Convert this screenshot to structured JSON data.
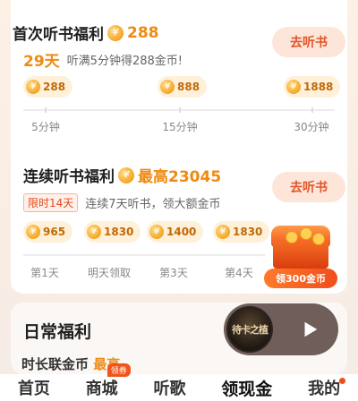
{
  "first_listen": {
    "title": "首次听书福利",
    "reward": "288",
    "days": "29天",
    "desc": "听满5分钟得288金币!",
    "button": "去听书",
    "pills": [
      "288",
      "888",
      "1888"
    ],
    "ticks": [
      "5分钟",
      "15分钟",
      "30分钟"
    ]
  },
  "continuous": {
    "title": "连续听书福利",
    "reward": "最高23045",
    "tag": "限时14天",
    "desc": "连续7天听书，领大额金币",
    "button": "去听书",
    "pills": [
      "965",
      "1830",
      "1400",
      "1830"
    ],
    "days": [
      "第1天",
      "明天领取",
      "第3天",
      "第4天"
    ],
    "chest_button": "领300金币"
  },
  "daily": {
    "title": "日常福利",
    "peek_text": "时长联金币",
    "peek_orange": "最高"
  },
  "player": {
    "cover_text": "待卡之植"
  },
  "tabs": [
    {
      "label": "首页"
    },
    {
      "label": "商城",
      "badge": "领券"
    },
    {
      "label": "听歌"
    },
    {
      "label": "领现金"
    },
    {
      "label": "我的"
    }
  ],
  "colors": {
    "accent": "#f08a12",
    "primary_action": "#e0562a",
    "badge": "#f0541a"
  },
  "icons": {
    "coin": "coin-icon",
    "play": "play-icon",
    "chest": "treasure-chest-icon"
  }
}
